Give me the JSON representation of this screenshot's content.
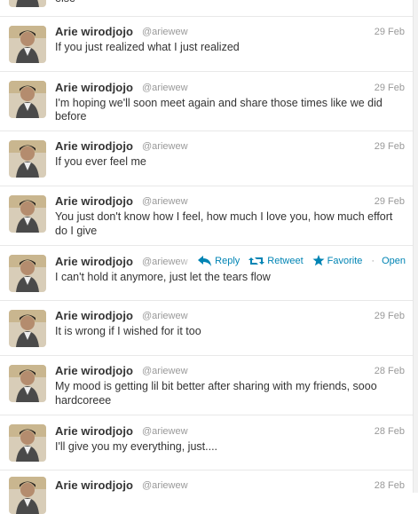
{
  "partial_top": {
    "text": "else"
  },
  "tweets": [
    {
      "name": "Arie wirodjojo",
      "handle": "@ariewew",
      "time": "29 Feb",
      "lines": [
        "If you just realized what I just realized"
      ]
    },
    {
      "name": "Arie wirodjojo",
      "handle": "@ariewew",
      "time": "29 Feb",
      "lines": [
        "I'm hoping we'll soon meet again and share those times like we did",
        "before"
      ]
    },
    {
      "name": "Arie wirodjojo",
      "handle": "@ariewew",
      "time": "29 Feb",
      "lines": [
        "If you ever feel me"
      ]
    },
    {
      "name": "Arie wirodjojo",
      "handle": "@ariewew",
      "time": "29 Feb",
      "lines": [
        "You just don't know how I feel, how much I love you, how much effort",
        "do I give"
      ]
    },
    {
      "name": "Arie wirodjojo",
      "handle": "@ariewew",
      "lines": [
        "I can't hold it anymore, just let the tears flow"
      ],
      "actions": {
        "reply": "Reply",
        "retweet": "Retweet",
        "favorite": "Favorite",
        "separator": "·",
        "open": "Open"
      }
    },
    {
      "name": "Arie wirodjojo",
      "handle": "@ariewew",
      "time": "29 Feb",
      "lines": [
        "It is wrong if I wished for it too"
      ]
    },
    {
      "name": "Arie wirodjojo",
      "handle": "@ariewew",
      "time": "28 Feb",
      "lines": [
        "My mood is getting lil bit better after sharing with my friends, sooo",
        "hardcoreee"
      ]
    },
    {
      "name": "Arie wirodjojo",
      "handle": "@ariewew",
      "time": "28 Feb",
      "lines": [
        "I'll give you my everything, just...."
      ]
    },
    {
      "name": "Arie wirodjojo",
      "handle": "@ariewew",
      "time": "28 Feb",
      "lines": []
    }
  ],
  "colors": {
    "link": "#0084b4",
    "muted": "#999999",
    "text": "#333333",
    "divider": "#e8e8e8"
  },
  "icons": {
    "reply": "reply-arrow-icon",
    "retweet": "retweet-icon",
    "favorite": "star-icon"
  }
}
